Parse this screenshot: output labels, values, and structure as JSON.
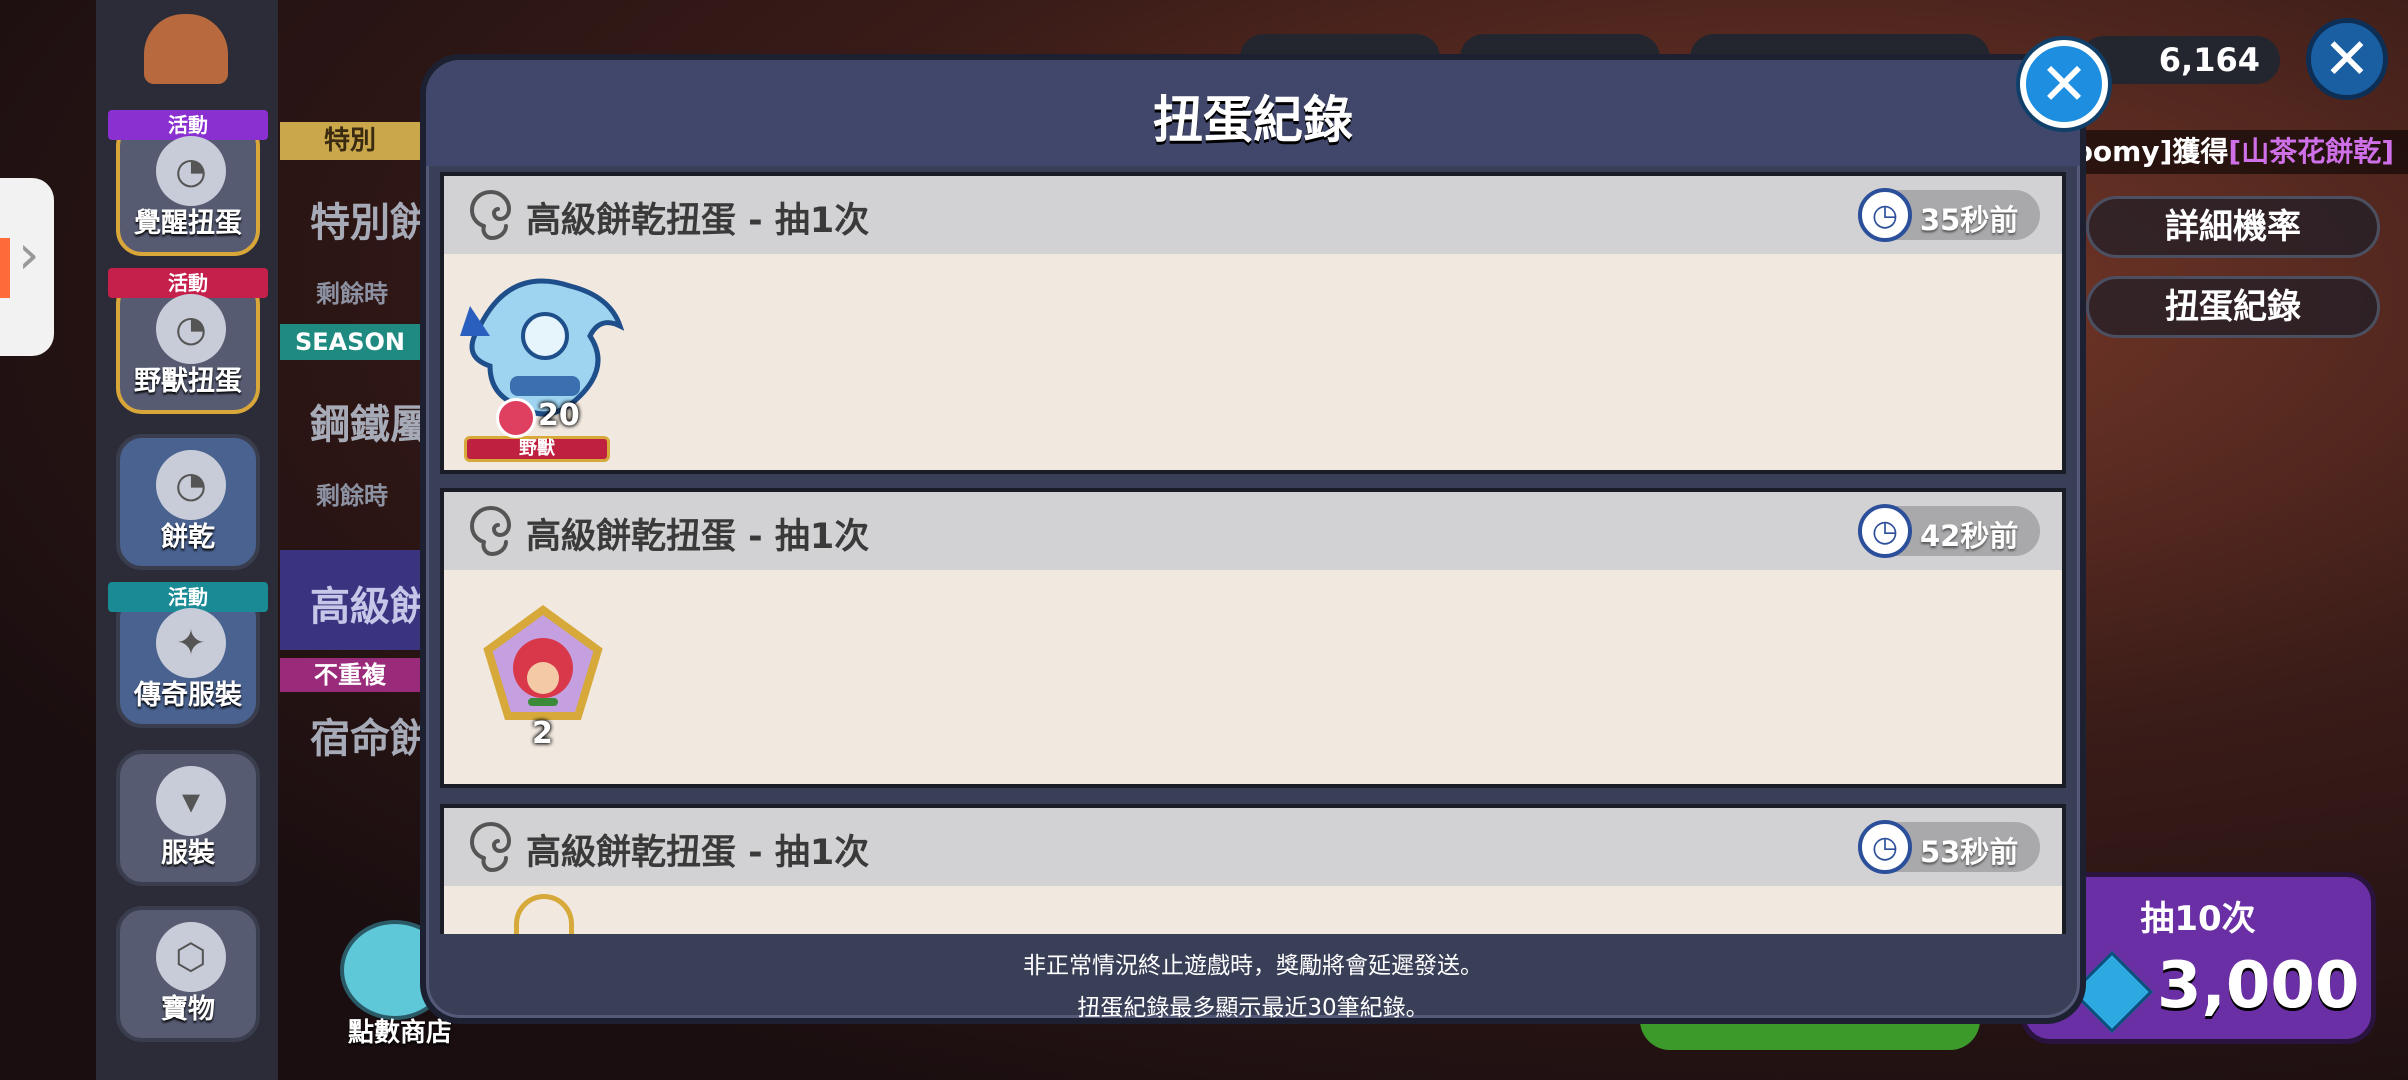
{
  "modal": {
    "title": "扭蛋紀錄",
    "entries": [
      {
        "title": "高級餅乾扭蛋 - 抽1次",
        "time": "35秒前",
        "reward_count": "20",
        "reward_tag": "野獸"
      },
      {
        "title": "高級餅乾扭蛋 - 抽1次",
        "time": "42秒前",
        "reward_count": "2"
      },
      {
        "title": "高級餅乾扭蛋 - 抽1次",
        "time": "53秒前"
      }
    ],
    "footer_line1": "非正常情況終止遊戲時，獎勵將會延遲發送。",
    "footer_line2": "扭蛋紀錄最多顯示最近30筆紀錄。"
  },
  "sidebar": {
    "items": [
      {
        "label": "覺醒扭蛋",
        "ribbon": "活動"
      },
      {
        "label": "野獸扭蛋",
        "ribbon": "活動"
      },
      {
        "label": "餅乾"
      },
      {
        "label": "傳奇服裝",
        "ribbon": "活動"
      },
      {
        "label": "服裝"
      },
      {
        "label": "寶物"
      }
    ]
  },
  "background": {
    "tag_special": "特別",
    "special_title": "特別餅",
    "remaining_1": "剩餘時",
    "season_tag": "SEASON",
    "steel_title": "鋼鐵屬",
    "remaining_2": "剩餘時",
    "premium_title": "高級餅",
    "no_repeat_tag": "不重複",
    "fate_title": "宿命餅",
    "shop_label": "點數商店"
  },
  "topbar": {
    "gems": "6,164"
  },
  "right_panel": {
    "notice_user": "[mushroomy]獲得",
    "notice_item": "[山茶花餅乾]",
    "rates_button": "詳細機率",
    "history_button": "扭蛋紀錄",
    "draw10_label": "抽10次",
    "draw10_price": "3,000"
  },
  "colors": {
    "modal_bg": "#3a3f58",
    "card_bg": "#f1e8df",
    "card_header": "#d2d1d3",
    "purple_button": "#6a2fa5"
  }
}
